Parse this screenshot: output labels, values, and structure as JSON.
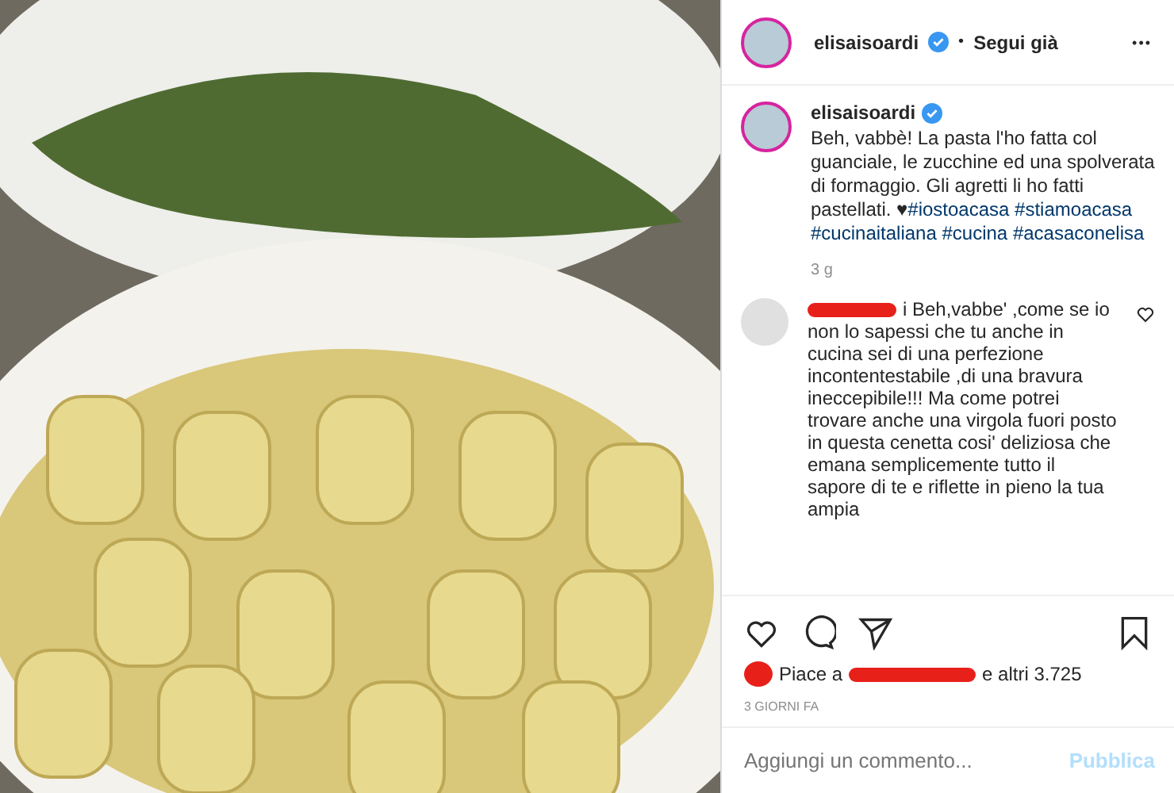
{
  "header": {
    "username": "elisaisoardi",
    "verified": true,
    "separator": "•",
    "follow": "Segui già",
    "more": "•••"
  },
  "caption": {
    "username": "elisaisoardi",
    "verified": true,
    "text": "Beh, vabbè! La pasta l'ho fatta col guanciale, le zucchine ed una spolverata di formaggio. Gli agretti li ho fatti pastellati. ♥",
    "hashtags": [
      "#iostoacasa",
      "#stiamoacasa",
      "#cucinaitaliana",
      "#cucina",
      "#acasaconelisa"
    ],
    "age": "3 g"
  },
  "comments": [
    {
      "redacted": true,
      "text": "i Beh,vabbe' ,come se io non lo sapessi che tu anche in cucina sei di una perfezione incontentestabile ,di una bravura ineccepibile!!! Ma come potrei trovare anche una virgola fuori posto in questa cenetta cosi' deliziosa che emana semplicemente tutto il sapore di te e riflette in pieno la tua ampia",
      "liked": false
    }
  ],
  "likes": {
    "prefix": "Piace a",
    "suffix": "e altri 3.725"
  },
  "date": "3 GIORNI FA",
  "comment_field": {
    "placeholder": "Aggiungi un commento...",
    "submit": "Pubblica",
    "submit_enabled": false
  }
}
